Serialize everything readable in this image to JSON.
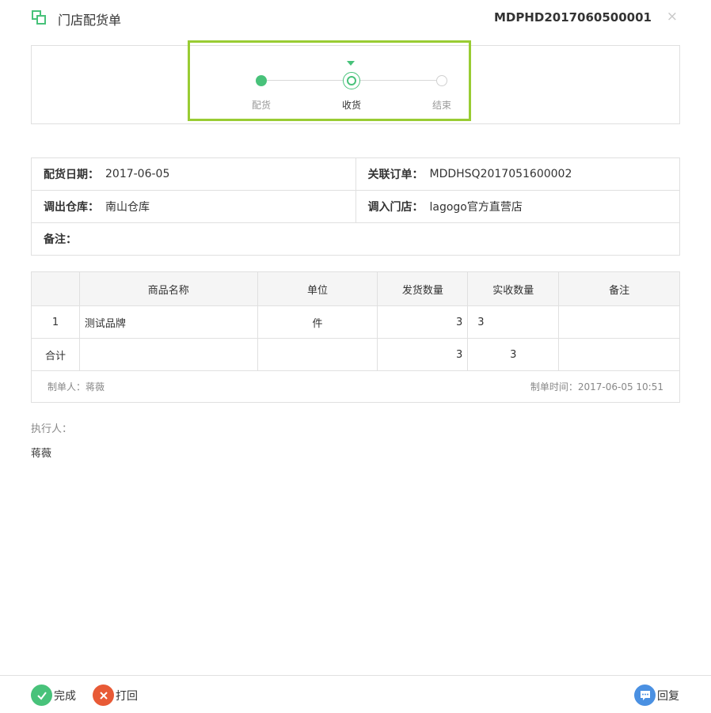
{
  "header": {
    "title": "门店配货单",
    "code": "MDPHD2017060500001",
    "close": "×"
  },
  "steps": [
    {
      "label": "配货",
      "state": "done"
    },
    {
      "label": "收货",
      "state": "current"
    },
    {
      "label": "结束",
      "state": "todo"
    }
  ],
  "info": {
    "date_label": "配货日期：",
    "date_value": "2017-06-05",
    "order_label": "关联订单：",
    "order_value": "MDDHSQ2017051600002",
    "out_label": "调出仓库：",
    "out_value": "南山仓库",
    "in_label": "调入门店：",
    "in_value": "lagogo官方直营店",
    "remark_label": "备注：",
    "remark_value": ""
  },
  "table": {
    "headers": [
      "",
      "商品名称",
      "单位",
      "发货数量",
      "实收数量",
      "备注"
    ],
    "rows": [
      {
        "no": "1",
        "name": "测试品牌",
        "unit": "件",
        "sent": "3",
        "received": "3",
        "remark": ""
      }
    ],
    "total": {
      "label": "合计",
      "sent": "3",
      "received": "3"
    },
    "creator": "制单人：蒋薇",
    "created_time": "制单时间：2017-06-05 10:51"
  },
  "executor": {
    "label": "执行人：",
    "name": "蒋薇"
  },
  "footer": {
    "done_label": "完成",
    "reject_label": "打回",
    "reply_label": "回复"
  },
  "colors": {
    "accent": "#48c27a",
    "highlight": "#99cc33",
    "reject": "#e85a36",
    "reply": "#4a90e2"
  }
}
